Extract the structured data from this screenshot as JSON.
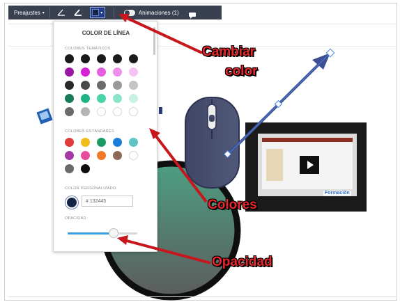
{
  "toolbar": {
    "presets_label": "Preajustes",
    "presets_caret": "▾",
    "color_caret": "▾",
    "animations_label": "Animaciones (1)",
    "current_color": "#132445"
  },
  "panel": {
    "title": "COLOR DE LÍNEA",
    "theme_label": "COLORES TEMÁTICOS",
    "standard_label": "COLORES ESTÁNDARES",
    "custom_label": "COLOR PERSONALIZADO",
    "custom_hex": "# 132445",
    "opacity_label": "OPACIDAD",
    "opacity_value": 0.66,
    "theme_colors": [
      "#1a1a1a",
      "#1a1a1a",
      "#1a1a1a",
      "#1a1a1a",
      "#1a1a1a",
      "#9b16a3",
      "#d820d6",
      "#e45ce0",
      "#ee8fec",
      "#f6c2f4",
      "#2a2a2a",
      "#4a4a4a",
      "#6b6b6b",
      "#9a9a9a",
      "#c4c4c4",
      "#1a7b5c",
      "#1fb388",
      "#48d4a9",
      "#8be4c9",
      "#c6f1e3",
      "#6b6b6b",
      "#b4b4b4",
      "#ffffff",
      "#ffffff",
      "#ffffff"
    ],
    "standard_colors": [
      "#e03a3a",
      "#f2bd1c",
      "#1c9a63",
      "#1c7ed6",
      "#5ec3c3",
      "#a43aa6",
      "#e74c9c",
      "#f07a28",
      "#8c6a55",
      "#ffffff",
      "#6b6b6b",
      "#0e0e0e"
    ]
  },
  "annotations": {
    "cambiar": "Cambiar",
    "color": "color",
    "colores": "Colores",
    "opacidad": "Opacidad"
  },
  "thumbnail": {
    "brand": "Formación"
  }
}
